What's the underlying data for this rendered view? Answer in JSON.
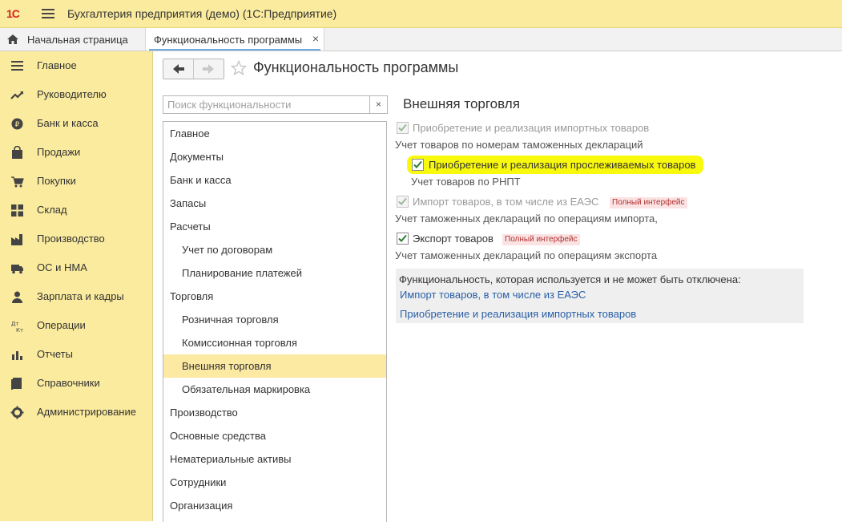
{
  "app": {
    "logo_text": "1С",
    "title": "Бухгалтерия предприятия (демо)  (1С:Предприятие)"
  },
  "tabs": {
    "home": "Начальная страница",
    "active": "Функциональность программы",
    "close_glyph": "×"
  },
  "sidebar": {
    "items": [
      {
        "label": "Главное",
        "icon": "list-icon"
      },
      {
        "label": "Руководителю",
        "icon": "trend-icon"
      },
      {
        "label": "Банк и касса",
        "icon": "ruble-coin-icon"
      },
      {
        "label": "Продажи",
        "icon": "shopping-bag-icon"
      },
      {
        "label": "Покупки",
        "icon": "cart-icon"
      },
      {
        "label": "Склад",
        "icon": "grid-boxes-icon"
      },
      {
        "label": "Производство",
        "icon": "factory-icon"
      },
      {
        "label": "ОС и НМА",
        "icon": "truck-icon"
      },
      {
        "label": "Зарплата и кадры",
        "icon": "person-icon"
      },
      {
        "label": "Операции",
        "icon": "dt-kt-icon"
      },
      {
        "label": "Отчеты",
        "icon": "bar-chart-icon"
      },
      {
        "label": "Справочники",
        "icon": "book-icon"
      },
      {
        "label": "Администрирование",
        "icon": "gear-icon"
      }
    ]
  },
  "page": {
    "title": "Функциональность программы",
    "search_placeholder": "Поиск функциональности",
    "search_clear": "×"
  },
  "categories": [
    {
      "label": "Главное",
      "indent": false,
      "selected": false
    },
    {
      "label": "Документы",
      "indent": false,
      "selected": false
    },
    {
      "label": "Банк и касса",
      "indent": false,
      "selected": false
    },
    {
      "label": "Запасы",
      "indent": false,
      "selected": false
    },
    {
      "label": "Расчеты",
      "indent": false,
      "selected": false
    },
    {
      "label": "Учет по договорам",
      "indent": true,
      "selected": false
    },
    {
      "label": "Планирование платежей",
      "indent": true,
      "selected": false
    },
    {
      "label": "Торговля",
      "indent": false,
      "selected": false
    },
    {
      "label": "Розничная торговля",
      "indent": true,
      "selected": false
    },
    {
      "label": "Комиссионная торговля",
      "indent": true,
      "selected": false
    },
    {
      "label": "Внешняя торговля",
      "indent": true,
      "selected": true
    },
    {
      "label": "Обязательная маркировка",
      "indent": true,
      "selected": false
    },
    {
      "label": "Производство",
      "indent": false,
      "selected": false
    },
    {
      "label": "Основные средства",
      "indent": false,
      "selected": false
    },
    {
      "label": "Нематериальные активы",
      "indent": false,
      "selected": false
    },
    {
      "label": "Сотрудники",
      "indent": false,
      "selected": false
    },
    {
      "label": "Организация",
      "indent": false,
      "selected": false
    }
  ],
  "section": {
    "title": "Внешняя торговля",
    "options": [
      {
        "label": "Приобретение и реализация импортных товаров",
        "description": "Учет товаров по номерам таможенных деклараций",
        "checked": true,
        "disabled": true,
        "badge": ""
      },
      {
        "label": "Приобретение и реализация прослеживаемых товаров",
        "description": "Учет товаров по РНПТ",
        "checked": true,
        "disabled": false,
        "badge": ""
      },
      {
        "label": "Импорт товаров, в том числе из ЕАЭС",
        "description": "Учет таможенных деклараций по операциям импорта,",
        "checked": true,
        "disabled": true,
        "badge": "Полный интерфейс"
      },
      {
        "label": "Экспорт товаров",
        "description": "Учет таможенных деклараций по операциям экспорта",
        "checked": true,
        "disabled": false,
        "badge": "Полный интерфейс"
      }
    ],
    "info": {
      "text": "Функциональность, которая используется и не может быть отключена:",
      "links": [
        "Импорт товаров, в том числе из ЕАЭС",
        "Приобретение и реализация импортных товаров"
      ]
    }
  },
  "colors": {
    "accent_yellow": "#fbeb9e",
    "selection": "#fce9a2",
    "highlight_marker": "#f9f90d",
    "check_green": "#2e7d32",
    "link_blue": "#2a5fa6",
    "logo_red": "#d5231e"
  }
}
